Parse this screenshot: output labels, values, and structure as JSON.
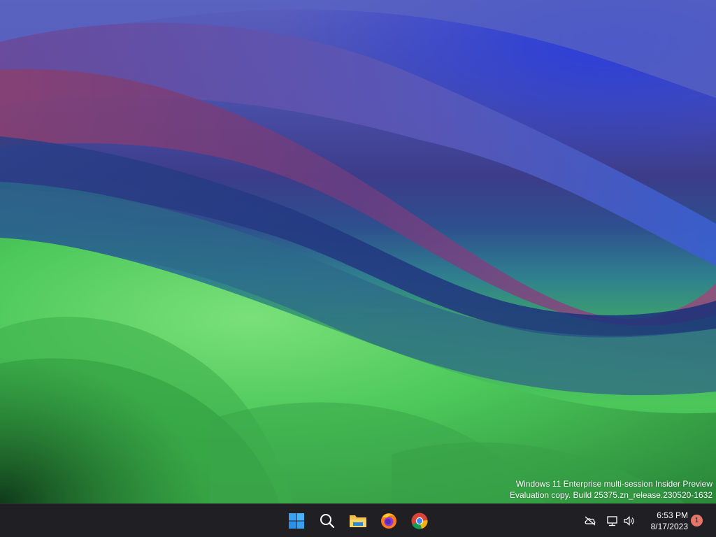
{
  "desktop": {
    "wallpaper": "macOS Sonoma style wave wallpaper",
    "watermark": {
      "line1": "Windows 11 Enterprise multi-session Insider Preview",
      "line2": "Evaluation copy. Build 25375.zn_release.230520-1632"
    }
  },
  "taskbar": {
    "pinned": [
      {
        "name": "start",
        "icon": "windows-logo-icon"
      },
      {
        "name": "search",
        "icon": "search-icon"
      },
      {
        "name": "file-explorer",
        "icon": "folder-icon"
      },
      {
        "name": "firefox",
        "icon": "firefox-icon"
      },
      {
        "name": "chrome",
        "icon": "chrome-icon"
      }
    ],
    "tray": {
      "icons": [
        "cloud-offline-icon",
        "network-icon",
        "volume-icon"
      ],
      "time": "6:53 PM",
      "date": "8/17/2023",
      "notification_count": "1"
    }
  },
  "colors": {
    "taskbar_bg": "#202024",
    "start_blue": "#3aa0f0",
    "badge": "#e8756a"
  }
}
